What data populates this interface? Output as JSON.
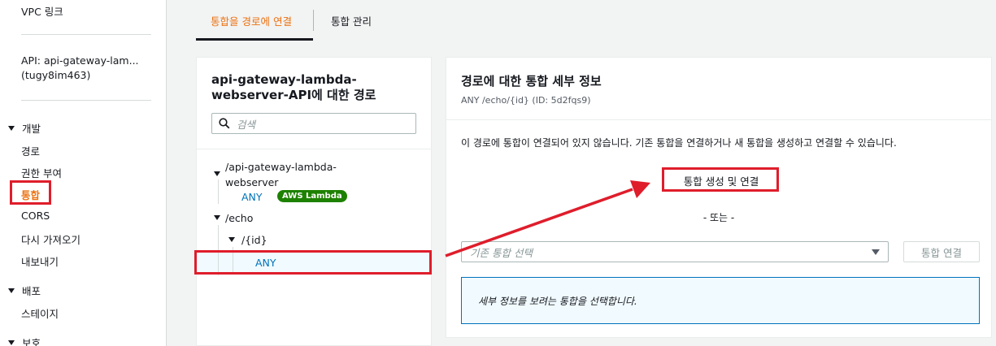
{
  "sidebar": {
    "vpc_link": "VPC 링크",
    "api_name_line1": "API: api-gateway-lam...",
    "api_name_line2": "(tugy8im463)",
    "sections": [
      {
        "label": "개발",
        "items": [
          "경로",
          "권한 부여",
          "통합",
          "CORS",
          "다시 가져오기",
          "내보내기"
        ]
      },
      {
        "label": "배포",
        "items": [
          "스테이지"
        ]
      },
      {
        "label": "보호",
        "items": []
      }
    ],
    "active_item": "통합"
  },
  "tabs": [
    {
      "label": "통합을 경로에 연결",
      "active": true
    },
    {
      "label": "통합 관리",
      "active": false
    }
  ],
  "routes": {
    "title": "api-gateway-lambda-webserver-API에 대한 경로",
    "search_placeholder": "검색",
    "tree": {
      "root_line1": "/api-gateway-lambda-",
      "root_line2": "webserver",
      "root_method": "ANY",
      "root_badge": "AWS Lambda",
      "echo": "/echo",
      "id": "/{id}",
      "id_method": "ANY"
    }
  },
  "detail": {
    "title": "경로에 대한 통합 세부 정보",
    "subtitle": "ANY /echo/{id} (ID: 5d2fqs9)",
    "message": "이 경로에 통합이 연결되어 있지 않습니다. 기존 통합을 연결하거나 새 통합을 생성하고 연결할 수 있습니다.",
    "create_button": "통합 생성 및 연결",
    "or_text": "- 또는 -",
    "select_placeholder": "기존 통합 선택",
    "connect_button": "통합 연결",
    "info_text": "세부 정보를 보려는 통합을 선택합니다."
  },
  "colors": {
    "accent": "#ec7211",
    "highlight": "#df1d2b",
    "link": "#0073bb",
    "badge": "#1d8102"
  }
}
